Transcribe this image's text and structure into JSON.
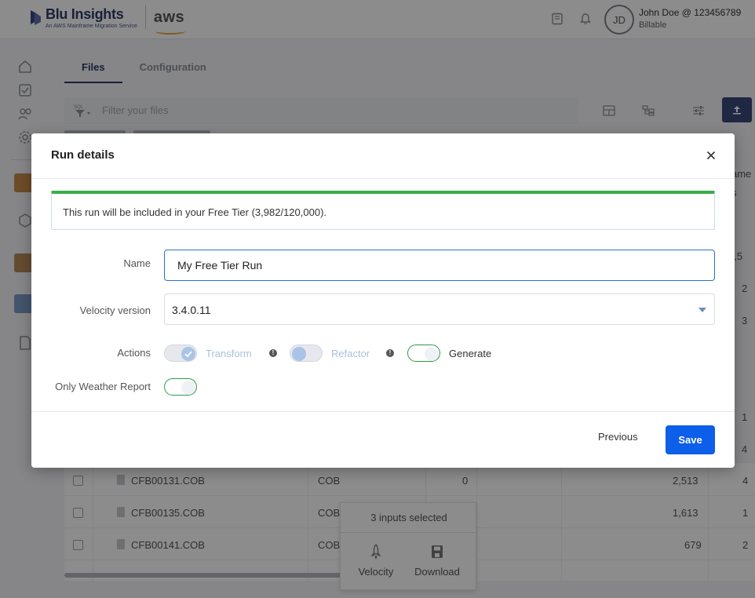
{
  "brand": {
    "name": "Blu Insights",
    "tagline": "An AWS Mainframe Migration Service",
    "partner": "aws",
    "colors": {
      "primary": "#2e3d6b",
      "aws_smile": "#e8a23a"
    }
  },
  "header": {
    "icons": [
      "book-icon",
      "bell-icon"
    ],
    "user": {
      "initials": "JD",
      "name": "John Doe @ 123456789",
      "role": "Billable"
    }
  },
  "sidebar": {
    "icons": [
      "home-icon",
      "checklist-icon",
      "users-icon",
      "gear-icon",
      "project-thumb",
      "hexagon-icon",
      "project-thumb-2",
      "chart-thumb",
      "document-icon"
    ]
  },
  "tabs": [
    {
      "label": "Files",
      "active": true
    },
    {
      "label": "Configuration",
      "active": false
    }
  ],
  "filter": {
    "prefix": "SQL",
    "placeholder": "Filter your files"
  },
  "table": {
    "rows": [
      {
        "name": "CFB00131.COB",
        "type": "COB",
        "count": "0",
        "size": "2,513",
        "extra": "4"
      },
      {
        "name": "CFB00135.COB",
        "type": "COB",
        "count": "",
        "size": "1,613",
        "extra": "1"
      },
      {
        "name": "CFB00141.COB",
        "type": "COB",
        "count": "",
        "size": "679",
        "extra": "2"
      }
    ],
    "right_column_peek": [
      "ame",
      "s",
      "0,5",
      "2",
      "3",
      "1",
      "4"
    ]
  },
  "selection": {
    "title": "3 inputs selected",
    "actions": [
      {
        "label": "Velocity",
        "icon": "rocket-icon"
      },
      {
        "label": "Download",
        "icon": "save-icon"
      }
    ]
  },
  "modal": {
    "title": "Run details",
    "info": "This run will be included in your Free Tier (3,982/120,000).",
    "fields": {
      "name_label": "Name",
      "name_value": "My Free Tier Run",
      "version_label": "Velocity version",
      "version_value": "3.4.0.11",
      "actions_label": "Actions",
      "weather_label": "Only Weather Report"
    },
    "actions": [
      {
        "label": "Transform",
        "state": "disabled-checked"
      },
      {
        "label": "Refactor",
        "state": "disabled"
      },
      {
        "label": "Generate",
        "state": "enabled"
      }
    ],
    "footer": {
      "previous": "Previous",
      "save": "Save"
    },
    "colors": {
      "success_bar": "#3aad4a",
      "primary_button": "#0d5ee8",
      "toggle_on_border": "#2f9a48"
    }
  }
}
